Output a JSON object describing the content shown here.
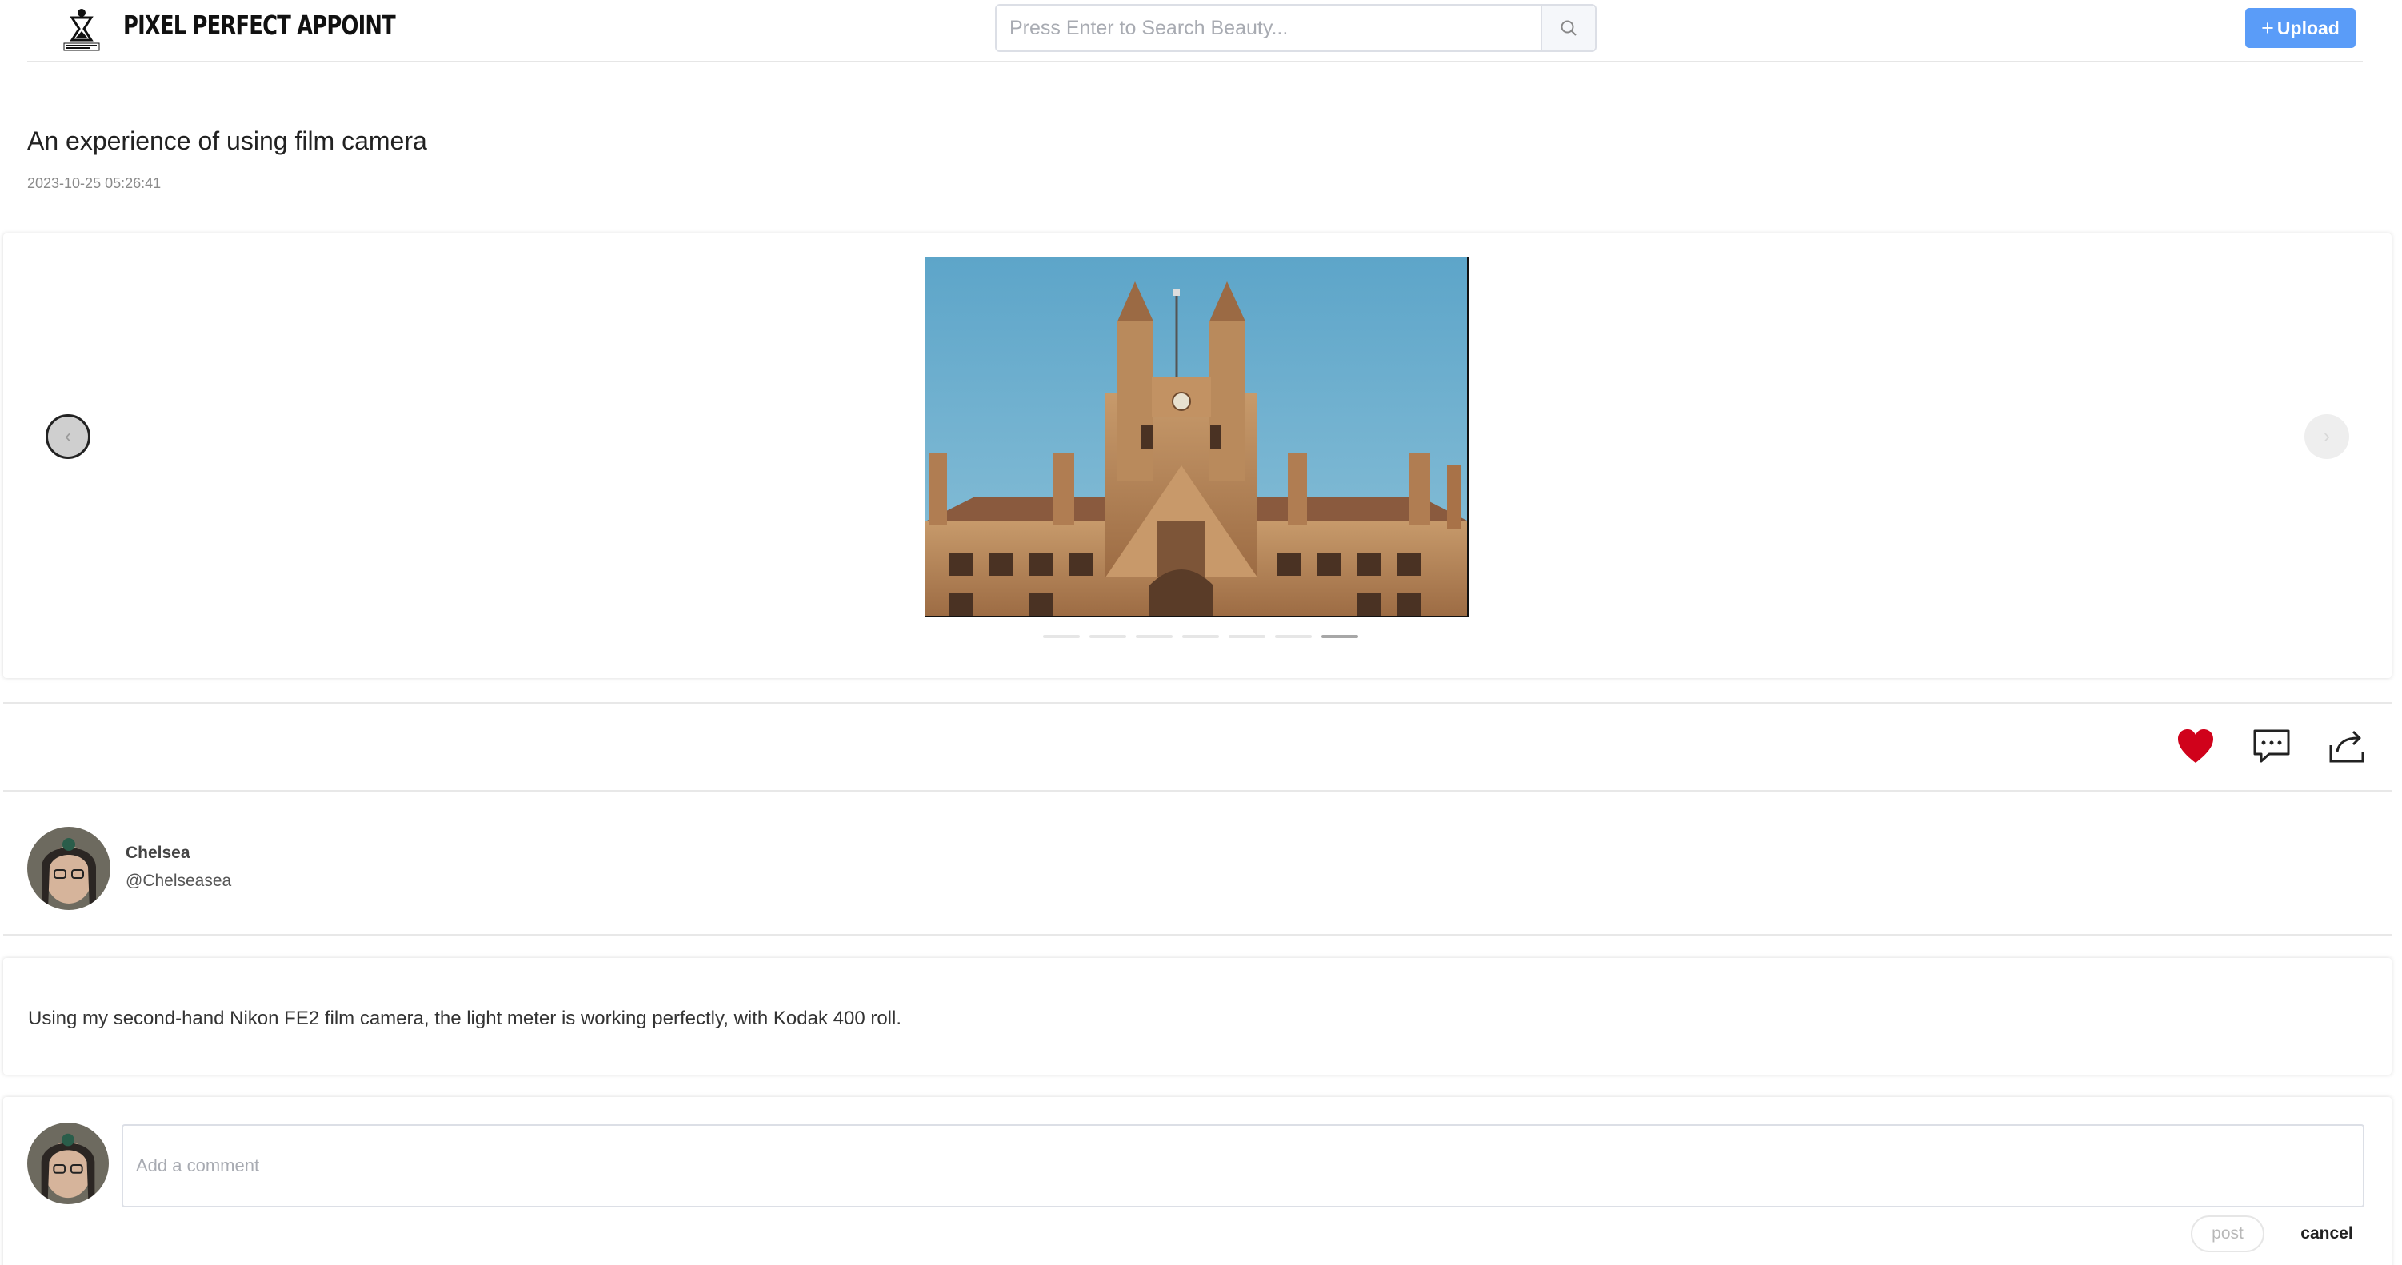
{
  "header": {
    "brand": "PIXEL PERFECT APPOINT",
    "search_placeholder": "Press Enter to Search Beauty...",
    "search_icon": "search-icon",
    "upload_plus": "+",
    "upload_label": "Upload"
  },
  "post": {
    "title": "An experience of using film camera",
    "date": "2023-10-25 05:26:41",
    "description": "Using my second-hand Nikon FE2 film camera, the light meter is working perfectly, with Kodak 400 roll."
  },
  "carousel": {
    "prev_label": "‹",
    "next_label": "›",
    "slide_count": 7,
    "active_slide": 7
  },
  "actions": {
    "like_icon": "heart-icon",
    "comment_icon": "comment-icon",
    "share_icon": "share-icon",
    "liked": true
  },
  "author": {
    "name": "Chelsea",
    "handle": "@Chelseasea"
  },
  "comment": {
    "placeholder": "Add a comment",
    "post_label": "post",
    "cancel_label": "cancel"
  },
  "colors": {
    "accent": "#5a9cf8",
    "like": "#d0021b"
  }
}
